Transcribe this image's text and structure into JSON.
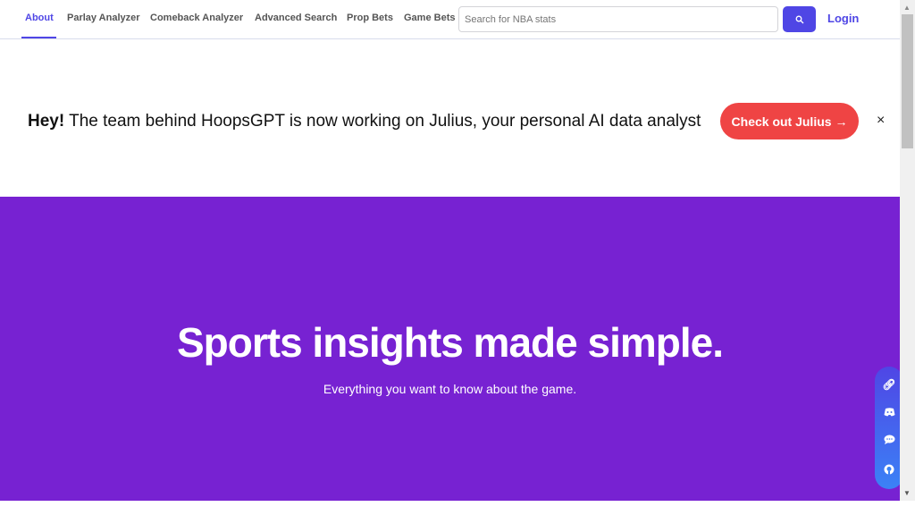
{
  "nav": {
    "items": [
      {
        "label": "About",
        "active": true
      },
      {
        "label": "Parlay Analyzer"
      },
      {
        "label": "Comeback Analyzer"
      },
      {
        "label": "Advanced Search"
      },
      {
        "label": "Prop Bets"
      },
      {
        "label": "Game Bets"
      }
    ],
    "search_placeholder": "Search for NBA stats",
    "search_icon": "magnifier",
    "login": "Login"
  },
  "banner": {
    "hey": "Hey!",
    "message": " The team behind HoopsGPT is now working on Julius, your personal AI data analyst",
    "cta": "Check out Julius →",
    "close": "×"
  },
  "hero": {
    "title": "Sports insights made simple.",
    "subtitle": "Everything you want to know about the game.",
    "background": "#7722d2"
  },
  "floating": {
    "icons": [
      "link",
      "discord",
      "chat",
      "github"
    ]
  },
  "colors": {
    "accent": "#4f46e5",
    "cta": "#ef4444"
  }
}
